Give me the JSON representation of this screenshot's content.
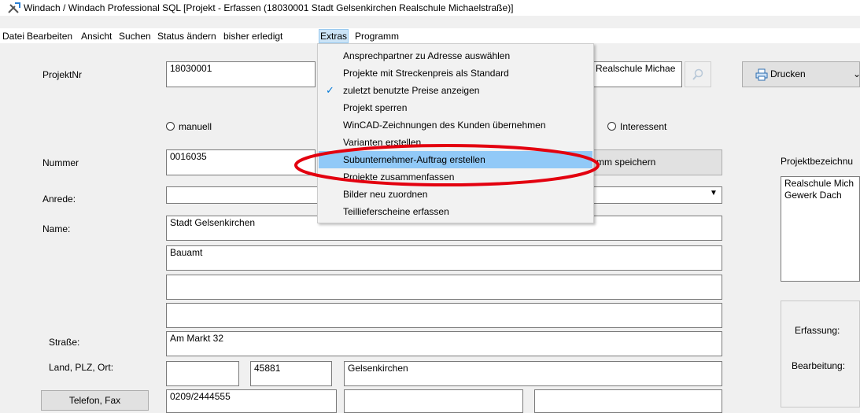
{
  "window": {
    "title": "Windach / Windach Professional SQL [Projekt - Erfassen (18030001 Stadt Gelsenkirchen Realschule Michaelstraße)]"
  },
  "menubar": {
    "items": [
      "Datei",
      "Bearbeiten",
      "Ansicht",
      "Suchen",
      "Status ändern",
      "bisher erledigt",
      "Extras",
      "Programm"
    ],
    "active": "Extras"
  },
  "extras_menu": {
    "items": [
      {
        "label": "Ansprechpartner zu Adresse auswählen",
        "checked": false
      },
      {
        "label": "Projekte mit Streckenpreis als Standard",
        "checked": false
      },
      {
        "label": "zuletzt benutzte Preise anzeigen",
        "checked": true
      },
      {
        "label": "Projekt sperren",
        "checked": false
      },
      {
        "label": "WinCAD-Zeichnungen des Kunden übernehmen",
        "checked": false
      },
      {
        "label": "Varianten erstellen",
        "checked": false
      },
      {
        "label": "Subunternehmer-Auftrag erstellen",
        "checked": false,
        "highlighted": true
      },
      {
        "label": "Projekte zusammenfassen",
        "checked": false
      },
      {
        "label": "Bilder neu zuordnen",
        "checked": false
      },
      {
        "label": "Teillieferscheine erfassen",
        "checked": false
      }
    ],
    "annotation_color": "#e3000f",
    "highlight_color": "#91c9f7"
  },
  "form": {
    "projektnr_label": "ProjektNr",
    "projektnr_value": "18030001",
    "project_name_partial": "Realschule Michae",
    "search_icon": "magnifier-icon",
    "print_label": "Drucken",
    "print_icon": "printer-icon",
    "radio_manuell": "manuell",
    "radio_interessent": "Interessent",
    "nummer_label": "Nummer",
    "nummer_value": "0016035",
    "save_button_partial": "mm speichern",
    "anrede_label": "Anrede:",
    "anrede_value": "",
    "name_label": "Name:",
    "name1": "Stadt Gelsenkirchen",
    "name2": "Bauamt",
    "name3": "",
    "name4": "",
    "strasse_label": "Straße:",
    "strasse_value": "Am Markt 32",
    "ort_label": "Land, PLZ, Ort:",
    "land_value": "",
    "plz_value": "45881",
    "ort_value": "Gelsenkirchen",
    "telefon_button": "Telefon, Fax",
    "telefon_value": "0209/2444555",
    "fax_value": "",
    "extra_phone_value": "",
    "projektbezeichnung_label": "Projektbezeichnu",
    "projektbezeichnung_line1": "Realschule Mich",
    "projektbezeichnung_line2": "Gewerk Dach",
    "erfassung_label": "Erfassung:",
    "bearbeitung_label": "Bearbeitung:"
  }
}
